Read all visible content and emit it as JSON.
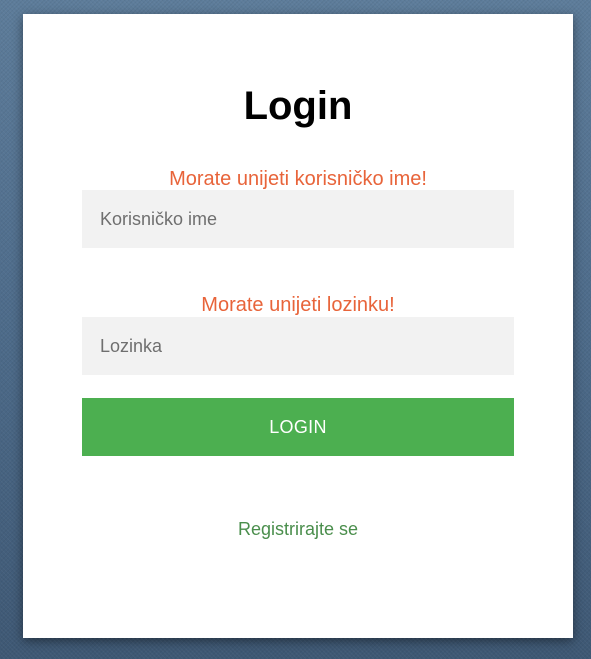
{
  "form": {
    "title": "Login",
    "username_error": "Morate unijeti korisničko ime!",
    "username_placeholder": "Korisničko ime",
    "username_value": "",
    "password_error": "Morate unijeti lozinku!",
    "password_placeholder": "Lozinka",
    "password_value": "",
    "login_label": "LOGIN",
    "register_label": "Registrirajte se"
  },
  "colors": {
    "background": "#51708f",
    "card": "#ffffff",
    "error_text": "#e8643a",
    "input_background": "#f2f2f2",
    "login_button": "#4caf50",
    "register_link": "#4a8e4c"
  }
}
